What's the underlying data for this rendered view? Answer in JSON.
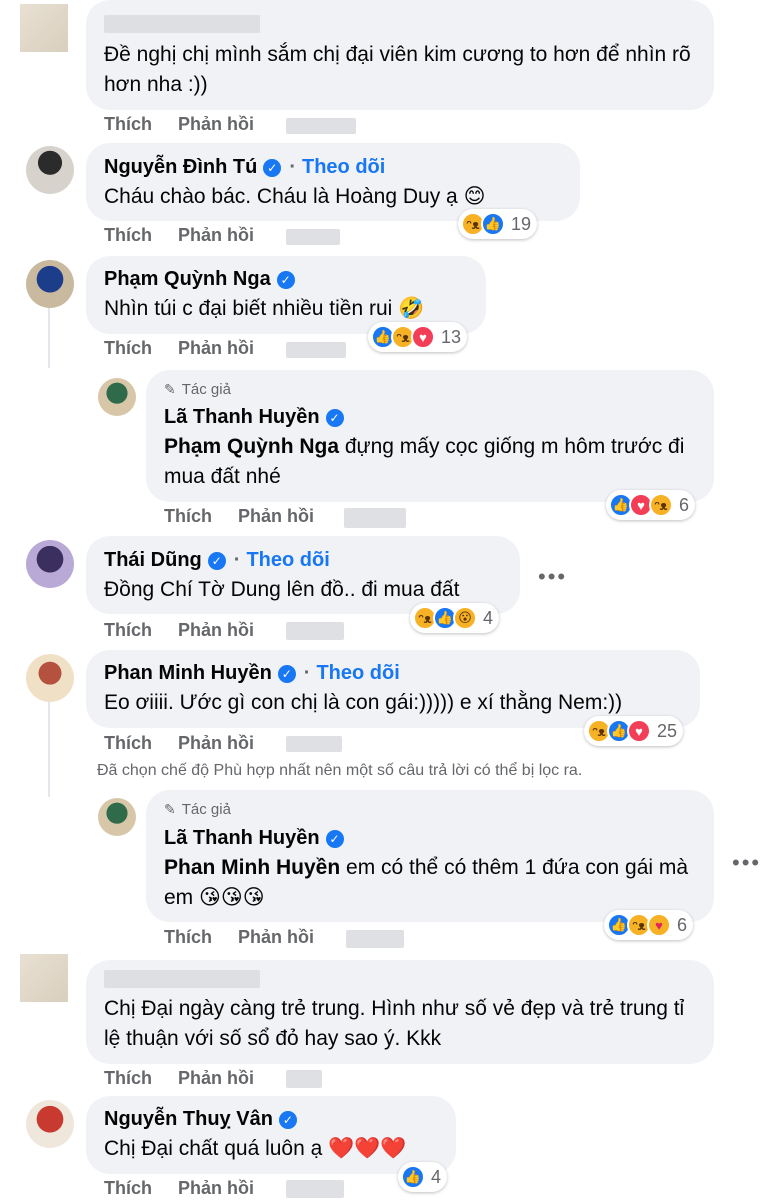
{
  "comments": [
    {
      "id": "c1",
      "name": "",
      "text": "Đề nghị chị mình sắm chị đại viên kim cương to hơn để nhìn rõ hơn nha :))",
      "like_label": "Thích",
      "reply_label": "Phản hồi"
    },
    {
      "id": "c2",
      "name": "Nguyễn Đình Tú",
      "follow": "Theo dõi",
      "text": "Cháu chào bác. Cháu là Hoàng Duy ạ 😊",
      "like_label": "Thích",
      "reply_label": "Phản hồi",
      "reactions": [
        "haha",
        "like"
      ],
      "reaction_count": "19"
    },
    {
      "id": "c3",
      "name": "Phạm Quỳnh Nga",
      "text": "Nhìn túi c đại biết nhiều tiền rui 🤣",
      "like_label": "Thích",
      "reply_label": "Phản hồi",
      "reactions": [
        "like",
        "haha",
        "love"
      ],
      "reaction_count": "13"
    },
    {
      "id": "c4",
      "author_tag": "Tác giả",
      "name": "Lã Thanh Huyền",
      "mention": "Phạm Quỳnh Nga",
      "text": " đựng mấy cọc giống m hôm trước đi mua đất nhé",
      "like_label": "Thích",
      "reply_label": "Phản hồi",
      "reactions": [
        "like",
        "love",
        "haha"
      ],
      "reaction_count": "6"
    },
    {
      "id": "c5",
      "name": "Thái Dũng",
      "follow": "Theo dõi",
      "text": "Đồng Chí Tờ Dung lên đồ.. đi mua đất",
      "like_label": "Thích",
      "reply_label": "Phản hồi",
      "reactions": [
        "haha",
        "like",
        "wow"
      ],
      "reaction_count": "4"
    },
    {
      "id": "c6",
      "name": "Phan Minh Huyền",
      "follow": "Theo dõi",
      "text": "Eo ơiiii. Ước gì con chị là con gái:))))) e xí thằng Nem:))",
      "like_label": "Thích",
      "reply_label": "Phản hồi",
      "reactions": [
        "haha",
        "like",
        "love"
      ],
      "reaction_count": "25"
    },
    {
      "id": "c7",
      "author_tag": "Tác giả",
      "name": "Lã Thanh Huyền",
      "mention": "Phan Minh Huyền",
      "text": " em có thể có thêm 1 đứa con gái mà em 😘😘😘",
      "like_label": "Thích",
      "reply_label": "Phản hồi",
      "reactions": [
        "like",
        "haha",
        "care"
      ],
      "reaction_count": "6"
    },
    {
      "id": "c8",
      "name": "",
      "text": "Chị Đại ngày càng trẻ trung. Hình như số vẻ đẹp và trẻ trung tỉ lệ thuận với số sổ đỏ hay sao ý. Kkk",
      "like_label": "Thích",
      "reply_label": "Phản hồi"
    },
    {
      "id": "c9",
      "name": "Nguyễn Thuỵ Vân",
      "text": "Chị Đại chất quá luôn ạ ❤️❤️❤️",
      "like_label": "Thích",
      "reply_label": "Phản hồi",
      "reactions": [
        "like"
      ],
      "reaction_count": "4"
    }
  ],
  "filter_note": "Đã chọn chế độ Phù hợp nhất nên một số câu trả lời có thể bị lọc ra.",
  "colors": {
    "bubble": "#f0f2f5",
    "link_blue": "#1877f2",
    "muted": "#65676b"
  }
}
